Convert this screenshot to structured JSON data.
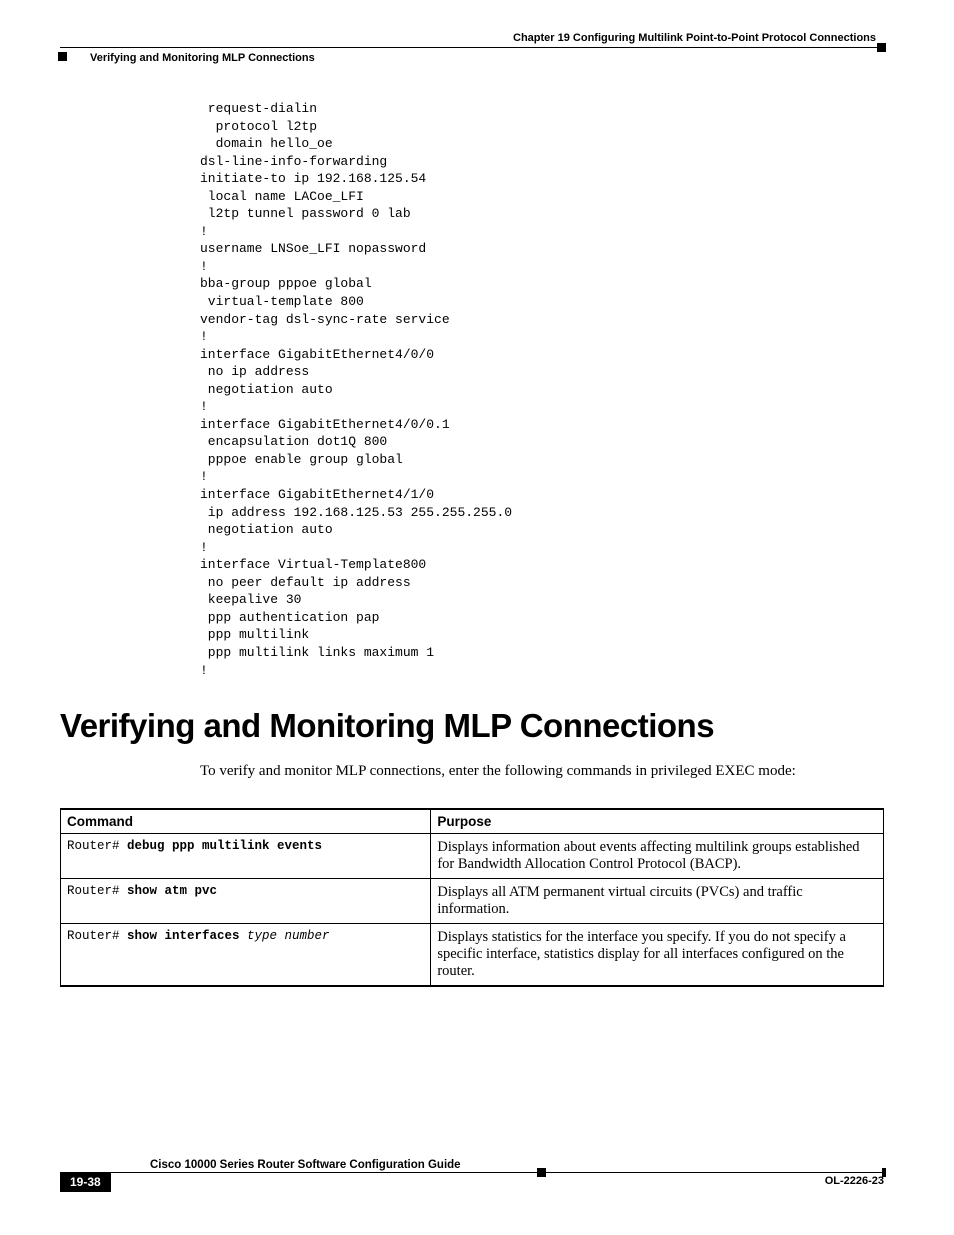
{
  "header": {
    "chapter_ref": "Chapter 19    Configuring Multilink Point-to-Point Protocol Connections",
    "section_ref": "Verifying and Monitoring MLP Connections"
  },
  "code_block": " request-dialin\n  protocol l2tp\n  domain hello_oe\ndsl-line-info-forwarding\ninitiate-to ip 192.168.125.54\n local name LACoe_LFI\n l2tp tunnel password 0 lab\n!\nusername LNSoe_LFI nopassword\n!\nbba-group pppoe global\n virtual-template 800\nvendor-tag dsl-sync-rate service\n!\ninterface GigabitEthernet4/0/0\n no ip address\n negotiation auto\n!\ninterface GigabitEthernet4/0/0.1\n encapsulation dot1Q 800\n pppoe enable group global\n!\ninterface GigabitEthernet4/1/0\n ip address 192.168.125.53 255.255.255.0\n negotiation auto\n!\ninterface Virtual-Template800\n no peer default ip address\n keepalive 30\n ppp authentication pap\n ppp multilink\n ppp multilink links maximum 1\n!",
  "section_heading": "Verifying and Monitoring MLP Connections",
  "intro_text": "To verify and monitor MLP connections, enter the following commands in privileged EXEC mode:",
  "table": {
    "col1_header": "Command",
    "col2_header": "Purpose",
    "rows": [
      {
        "prompt": "Router# ",
        "bold": "debug ppp multilink events",
        "italic": "",
        "purpose": "Displays information about events affecting multilink groups established for Bandwidth Allocation Control Protocol (BACP)."
      },
      {
        "prompt": "Router# ",
        "bold": "show atm pvc",
        "italic": "",
        "purpose": "Displays all ATM permanent virtual circuits (PVCs) and traffic information."
      },
      {
        "prompt": "Router# ",
        "bold": "show interfaces",
        "italic": " type number",
        "purpose": "Displays statistics for the interface you specify. If you do not specify a specific interface, statistics display for all interfaces configured on the router."
      }
    ]
  },
  "footer": {
    "guide_title": "Cisco 10000 Series Router Software Configuration Guide",
    "page_number": "19-38",
    "doc_id": "OL-2226-23"
  }
}
